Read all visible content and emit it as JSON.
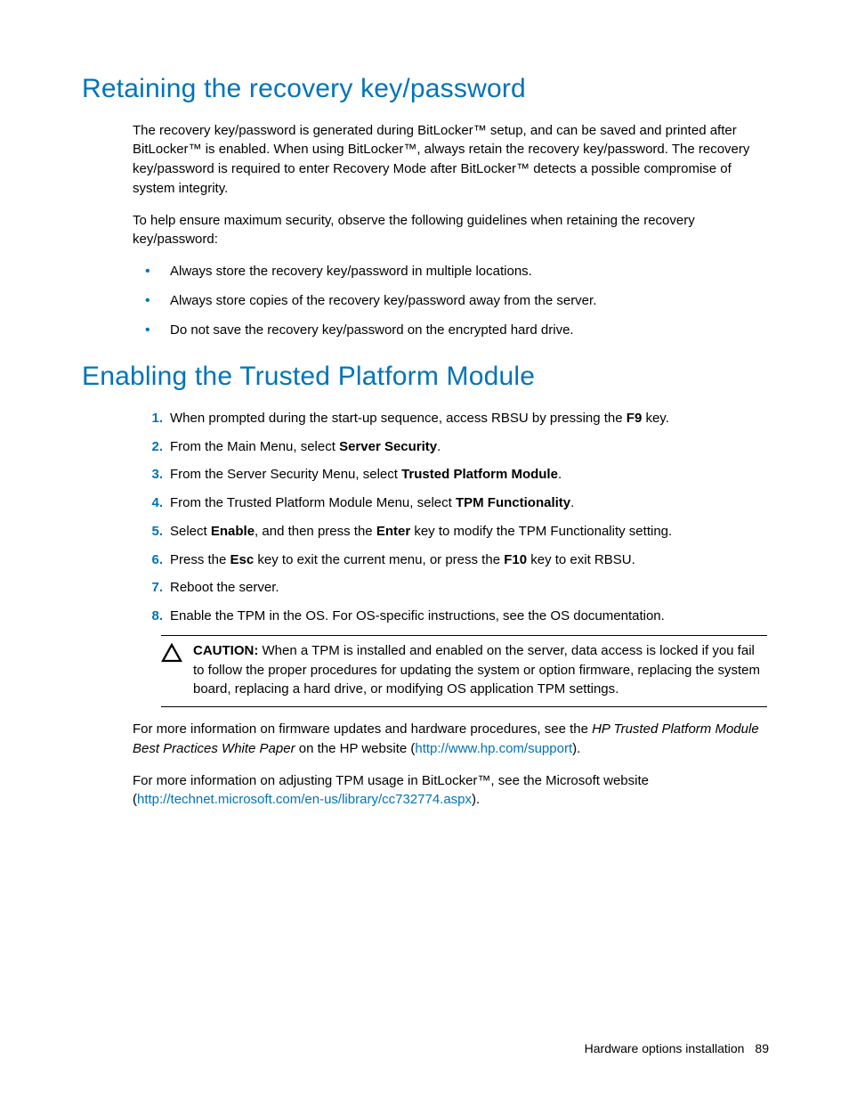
{
  "section1": {
    "heading": "Retaining the recovery key/password",
    "p1": "The recovery key/password is generated during BitLocker™ setup, and can be saved and printed after BitLocker™ is enabled. When using BitLocker™, always retain the recovery key/password. The recovery key/password is required to enter Recovery Mode after BitLocker™ detects a possible compromise of system integrity.",
    "p2": "To help ensure maximum security, observe the following guidelines when retaining the recovery key/password:",
    "bullets": [
      "Always store the recovery key/password in multiple locations.",
      "Always store copies of the recovery key/password away from the server.",
      "Do not save the recovery key/password on the encrypted hard drive."
    ]
  },
  "section2": {
    "heading": "Enabling the Trusted Platform Module",
    "steps": {
      "s1a": "When prompted during the start-up sequence, access RBSU by pressing the ",
      "s1b": "F9",
      "s1c": " key.",
      "s2a": "From the Main Menu, select ",
      "s2b": "Server Security",
      "s2c": ".",
      "s3a": "From the Server Security Menu, select ",
      "s3b": "Trusted Platform Module",
      "s3c": ".",
      "s4a": "From the Trusted Platform Module Menu, select ",
      "s4b": "TPM Functionality",
      "s4c": ".",
      "s5a": "Select ",
      "s5b": "Enable",
      "s5c": ", and then press the ",
      "s5d": "Enter",
      "s5e": " key to modify the TPM Functionality setting.",
      "s6a": "Press the ",
      "s6b": "Esc",
      "s6c": " key to exit the current menu, or press the ",
      "s6d": "F10",
      "s6e": " key to exit RBSU.",
      "s7": "Reboot the server.",
      "s8": "Enable the TPM in the OS. For OS-specific instructions, see the OS documentation."
    },
    "caution_label": "CAUTION:",
    "caution_text": "   When a TPM is installed and enabled on the server, data access is locked if you fail to follow the proper procedures for updating the system or option firmware, replacing the system board, replacing a hard drive, or modifying OS application TPM settings.",
    "p3a": "For more information on firmware updates and hardware procedures, see the ",
    "p3b": "HP Trusted Platform Module Best Practices White Paper",
    "p3c": " on the HP website (",
    "p3link": "http://www.hp.com/support",
    "p3d": ").",
    "p4a": "For more information on adjusting TPM usage in BitLocker™, see the Microsoft website (",
    "p4link": "http://technet.microsoft.com/en-us/library/cc732774.aspx",
    "p4b": ")."
  },
  "footer": {
    "label": "Hardware options installation",
    "page": "89"
  }
}
